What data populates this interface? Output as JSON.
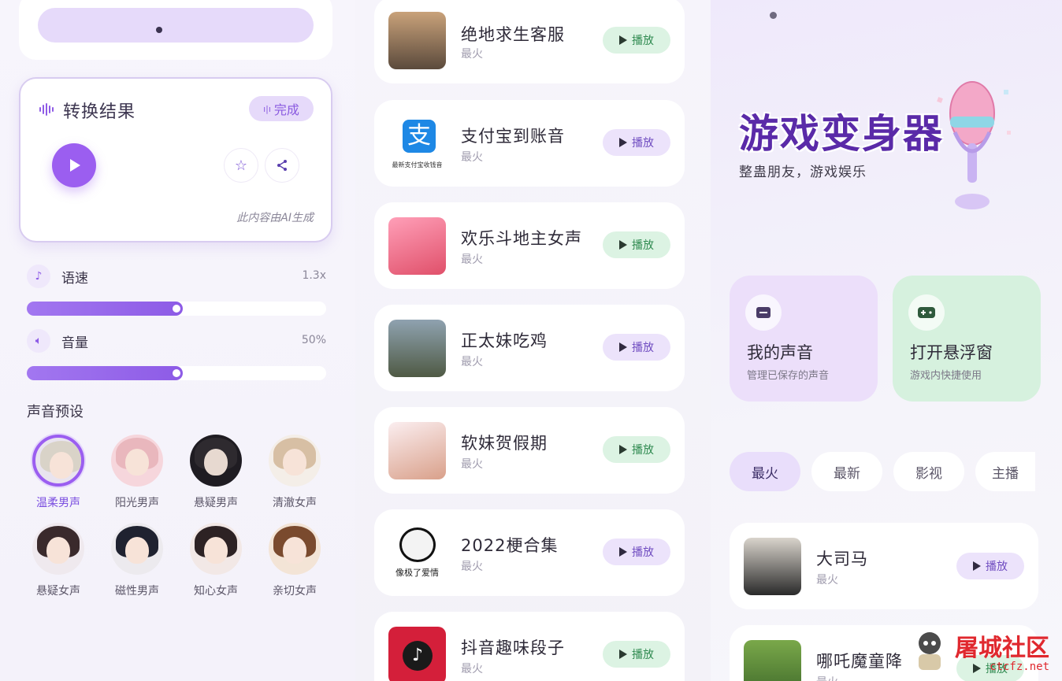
{
  "panel1": {
    "result_card": {
      "title": "转换结果",
      "done_label": "完成",
      "ai_note": "此内容由AI生成"
    },
    "speed": {
      "label": "语速",
      "value": "1.3x",
      "fraction": 0.5
    },
    "volume": {
      "label": "音量",
      "value": "50%",
      "fraction": 0.5
    },
    "presets_title": "声音预设",
    "presets": [
      {
        "name": "温柔男声",
        "selected": true
      },
      {
        "name": "阳光男声"
      },
      {
        "name": "悬疑男声"
      },
      {
        "name": "清澈女声"
      },
      {
        "name": "悬疑女声"
      },
      {
        "name": "磁性男声"
      },
      {
        "name": "知心女声"
      },
      {
        "name": "亲切女声"
      }
    ]
  },
  "panel2": {
    "songs": [
      {
        "name": "绝地求生客服",
        "tag": "最火",
        "play": "播放",
        "style": "green"
      },
      {
        "name": "支付宝到账音",
        "tag": "最火",
        "play": "播放",
        "style": "purple",
        "thumb_caption": "最新支付宝收钱音"
      },
      {
        "name": "欢乐斗地主女声",
        "tag": "最火",
        "play": "播放",
        "style": "green"
      },
      {
        "name": "正太妹吃鸡",
        "tag": "最火",
        "play": "播放",
        "style": "purple"
      },
      {
        "name": "软妹贺假期",
        "tag": "最火",
        "play": "播放",
        "style": "green"
      },
      {
        "name": "2022梗合集",
        "tag": "最火",
        "play": "播放",
        "style": "purple",
        "thumb_caption": "像极了爱情"
      },
      {
        "name": "抖音趣味段子",
        "tag": "最火",
        "play": "播放",
        "style": "green"
      }
    ]
  },
  "panel3": {
    "hero_title": "游戏变身器",
    "hero_sub": "整蛊朋友，游戏娱乐",
    "features": [
      {
        "title": "我的声音",
        "sub": "管理已保存的声音",
        "color": "#ecdffa",
        "icon": "folder-icon"
      },
      {
        "title": "打开悬浮窗",
        "sub": "游戏内快捷使用",
        "color": "#d6f1de",
        "icon": "gamepad-icon"
      }
    ],
    "tabs": [
      "最火",
      "最新",
      "影视",
      "主播"
    ],
    "songs": [
      {
        "name": "大司马",
        "tag": "最火",
        "play": "播放"
      },
      {
        "name": "哪吒魔童降",
        "tag": "最火",
        "play": "播放"
      }
    ],
    "watermark": {
      "title": "屠城社区",
      "url": "ctcfz.net"
    }
  },
  "colors": {
    "accent": "#9b5ef0",
    "green_button": "#dcf3e3",
    "purple_button": "#ece3fb"
  }
}
